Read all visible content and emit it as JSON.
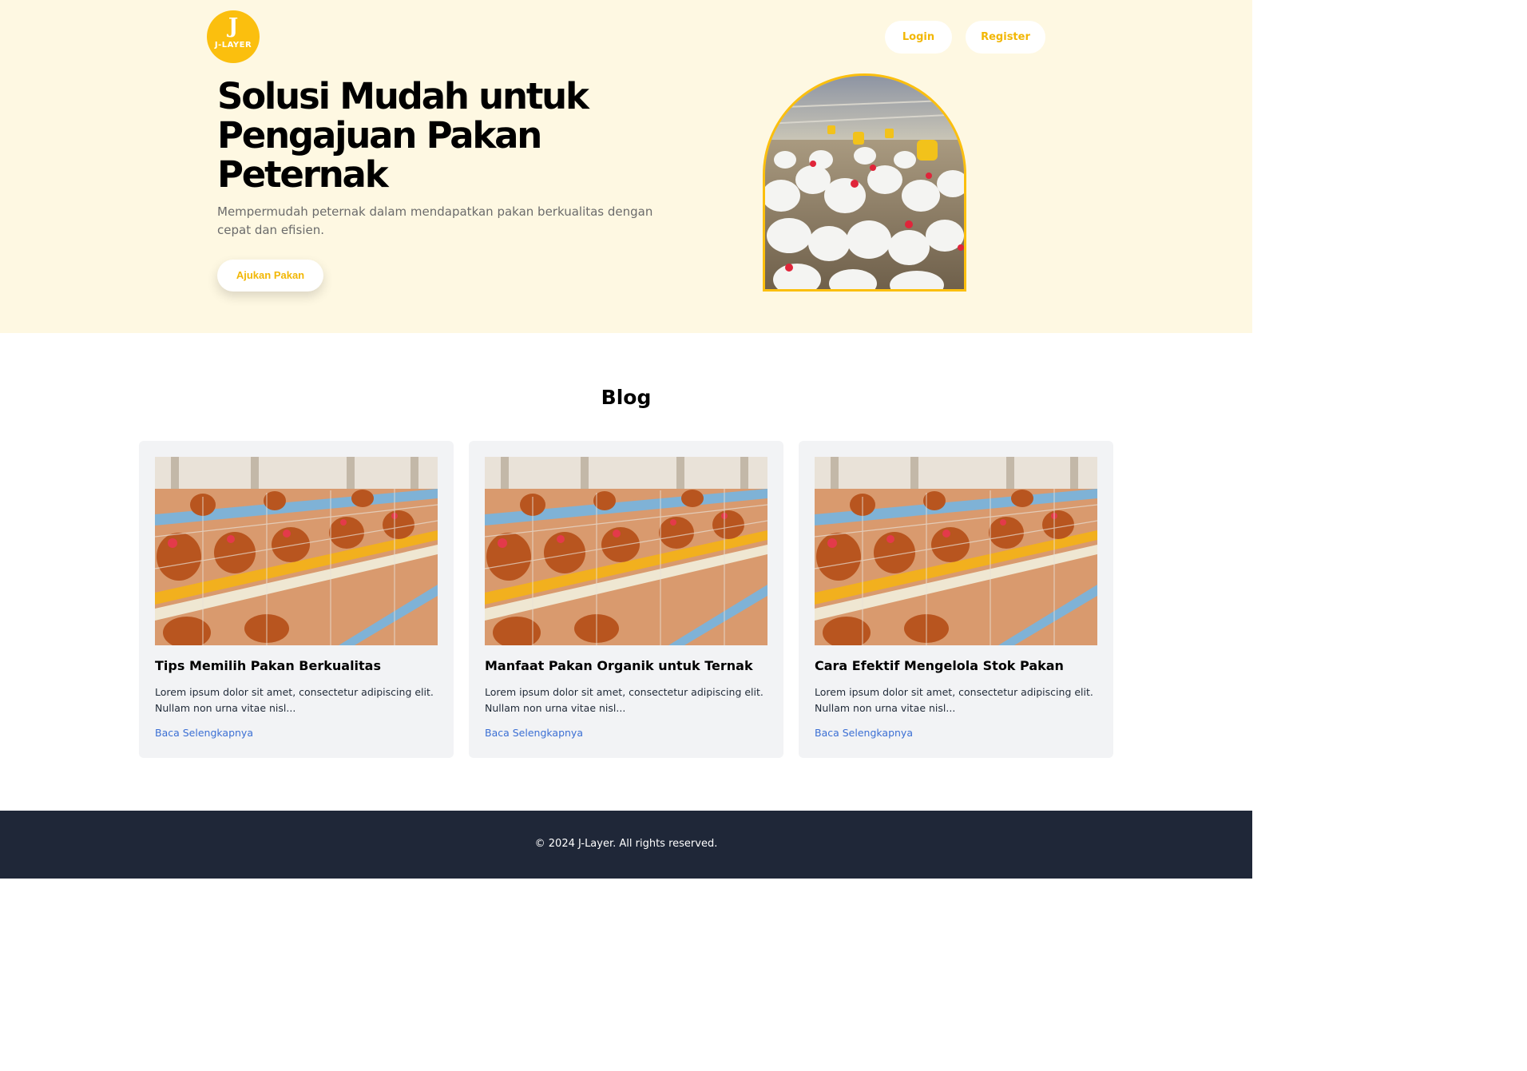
{
  "brand": {
    "logo_glyph": "J",
    "logo_text": "J-LAYER",
    "accent_color": "#fbbf0e"
  },
  "nav": {
    "login_label": "Login",
    "register_label": "Register"
  },
  "hero": {
    "title": "Solusi Mudah untuk Pengajuan Pakan Peternak",
    "subtitle": "Mempermudah peternak dalam mendapatkan pakan berkualitas dengan cepat dan efisien.",
    "cta_label": "Ajukan Pakan",
    "background_color": "#fef8e2"
  },
  "blog": {
    "heading": "Blog",
    "posts": [
      {
        "title": "Tips Memilih Pakan Berkualitas",
        "excerpt": "Lorem ipsum dolor sit amet, consectetur adipiscing elit. Nullam non urna vitae nisl...",
        "link_label": "Baca Selengkapnya"
      },
      {
        "title": "Manfaat Pakan Organik untuk Ternak",
        "excerpt": "Lorem ipsum dolor sit amet, consectetur adipiscing elit. Nullam non urna vitae nisl...",
        "link_label": "Baca Selengkapnya"
      },
      {
        "title": "Cara Efektif Mengelola Stok Pakan",
        "excerpt": "Lorem ipsum dolor sit amet, consectetur adipiscing elit. Nullam non urna vitae nisl...",
        "link_label": "Baca Selengkapnya"
      }
    ]
  },
  "footer": {
    "copyright": "© 2024 J-Layer. All rights reserved.",
    "background_color": "#1f2738"
  }
}
